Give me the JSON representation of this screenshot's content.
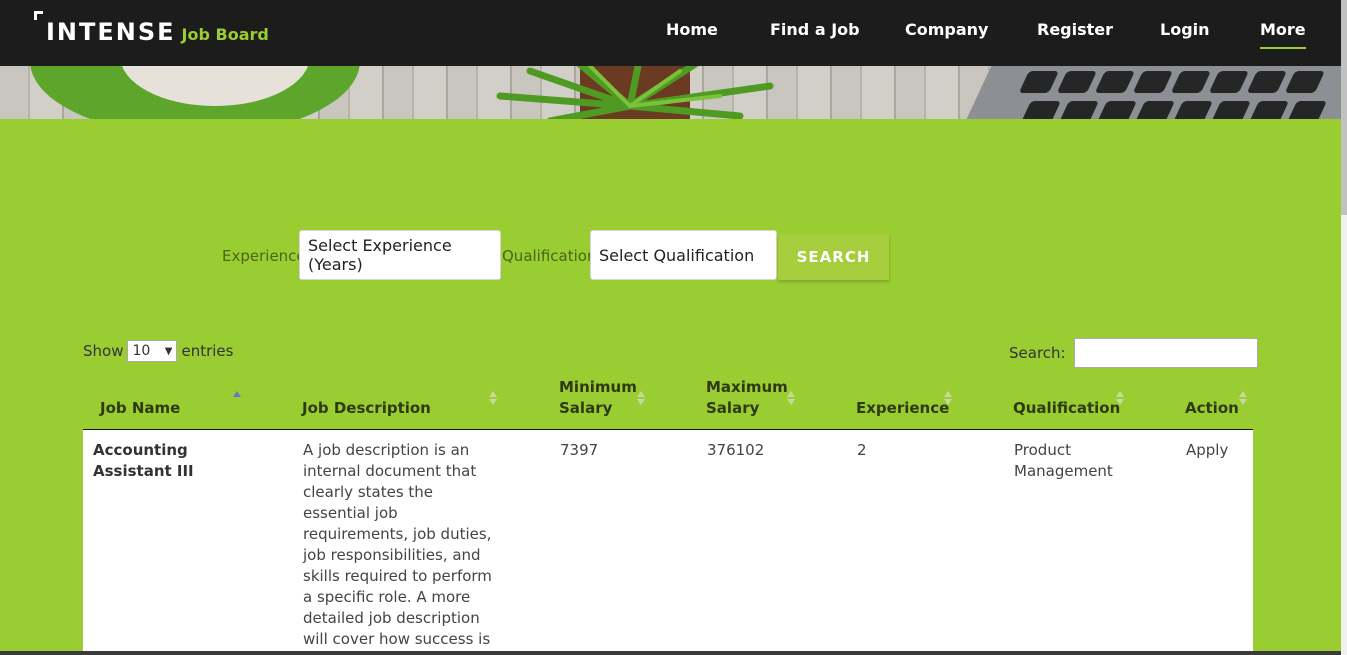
{
  "brand": {
    "name": "INTENSE",
    "tagline": "Job Board"
  },
  "nav": [
    {
      "label": "Home",
      "active": false
    },
    {
      "label": "Find a Job",
      "active": false
    },
    {
      "label": "Company",
      "active": false
    },
    {
      "label": "Register",
      "active": false
    },
    {
      "label": "Login",
      "active": false
    },
    {
      "label": "More",
      "active": true
    }
  ],
  "filters": {
    "experience_label": "Experience",
    "experience_value": "Select Experience (Years)",
    "qualification_label": "Qualification",
    "qualification_value": "Select Qualification",
    "search_button": "SEARCH"
  },
  "table_controls": {
    "show_label": "Show",
    "entries_value": "10",
    "entries_label": "entries",
    "search_label": "Search:",
    "search_value": ""
  },
  "table": {
    "columns": [
      "Job Name",
      "Job Description",
      "Minimum Salary",
      "Maximum Salary",
      "Experience",
      "Qualification",
      "Action"
    ],
    "sorted_column": "Job Name",
    "rows": [
      {
        "job_name": "Accounting Assistant III",
        "description": "A job description is an internal document that clearly states the essential job requirements, job duties, job responsibilities, and skills required to perform a specific role. A more detailed job description will cover how success is measured in the",
        "min_salary": "7397",
        "max_salary": "376102",
        "experience": "2",
        "qualification": "Product Management",
        "action": "Apply"
      }
    ]
  },
  "colors": {
    "accent_green": "#9acd32",
    "button_green": "#a6cd3c",
    "header_dark": "#1c1c1c"
  }
}
